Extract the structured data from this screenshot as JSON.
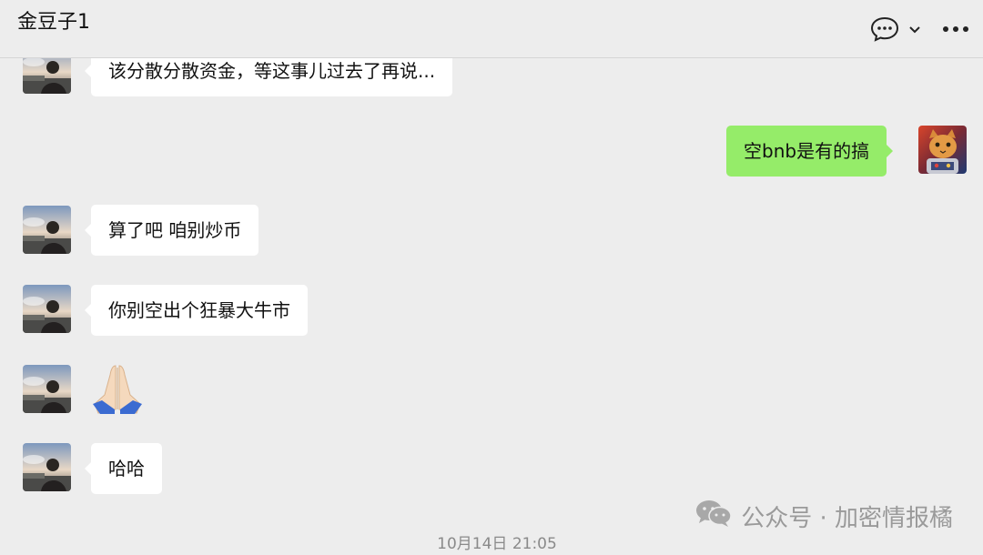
{
  "header": {
    "title": "金豆子1",
    "icons": [
      "chat-bubble-icon",
      "chevron-down-icon",
      "more-icon"
    ]
  },
  "messages": [
    {
      "side": "left",
      "type": "text",
      "text": "该分散分散资金，等这事儿过去了再说..."
    },
    {
      "side": "right",
      "type": "text",
      "text": "空bnb是有的搞"
    },
    {
      "side": "left",
      "type": "text",
      "text": "算了吧 咱别炒币"
    },
    {
      "side": "left",
      "type": "text",
      "text": "你别空出个狂暴大牛市"
    },
    {
      "side": "left",
      "type": "emoji",
      "emoji": "folded-hands"
    },
    {
      "side": "left",
      "type": "text",
      "text": "哈哈"
    }
  ],
  "timestamp": "10月14日 21:05",
  "watermark": "公众号 · 加密情报橘",
  "colors": {
    "background": "#ededed",
    "incoming_bubble": "#ffffff",
    "outgoing_bubble": "#95ec69"
  }
}
